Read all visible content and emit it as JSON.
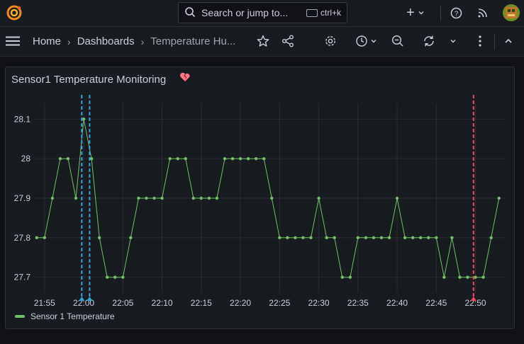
{
  "topbar": {
    "search_placeholder": "Search or jump to...",
    "search_shortcut": "ctrl+k",
    "icons": [
      "grafana-logo-icon",
      "search-icon",
      "keyboard-icon",
      "plus-icon",
      "help-icon",
      "news-icon",
      "avatar"
    ]
  },
  "navbar": {
    "breadcrumbs": [
      "Home",
      "Dashboards",
      "Temperature Hu..."
    ],
    "icons": [
      "menu-icon",
      "star-icon",
      "share-icon",
      "settings-icon",
      "time-picker-icon",
      "zoom-out-icon",
      "refresh-icon",
      "refresh-interval-chevron-icon",
      "more-icon",
      "collapse-icon"
    ]
  },
  "panel": {
    "title": "Sensor1 Temperature Monitoring",
    "title_icon": "broken-heart-icon"
  },
  "colors": {
    "series": "#73bf69",
    "annotation_blue": "#2aa8dc",
    "annotation_red": "#f2495c",
    "heart": "#ff7383",
    "grid": "#2a2d33"
  },
  "chart_data": {
    "type": "line",
    "title": "Sensor1 Temperature Monitoring",
    "xlabel": "",
    "ylabel": "",
    "x_ticks": [
      "21:55",
      "22:00",
      "22:05",
      "22:10",
      "22:15",
      "22:20",
      "22:25",
      "22:30",
      "22:35",
      "22:40",
      "22:45",
      "22:50"
    ],
    "y_ticks": [
      27.7,
      27.8,
      27.9,
      28,
      28.1
    ],
    "ylim": [
      27.66,
      28.14
    ],
    "xlim": [
      "21:53:45",
      "22:53:45"
    ],
    "grid": true,
    "legend": "bottom-left",
    "series": [
      {
        "name": "Sensor 1 Temperature",
        "x": [
          "21:54:00",
          "21:55:00",
          "21:56:00",
          "21:57:00",
          "21:58:00",
          "21:59:00",
          "22:00:00",
          "22:01:00",
          "22:02:00",
          "22:03:00",
          "22:04:00",
          "22:05:00",
          "22:06:00",
          "22:07:00",
          "22:08:00",
          "22:09:00",
          "22:10:00",
          "22:11:00",
          "22:12:00",
          "22:13:00",
          "22:14:00",
          "22:15:00",
          "22:16:00",
          "22:17:00",
          "22:18:00",
          "22:19:00",
          "22:20:00",
          "22:21:00",
          "22:22:00",
          "22:23:00",
          "22:24:00",
          "22:25:00",
          "22:26:00",
          "22:27:00",
          "22:28:00",
          "22:29:00",
          "22:30:00",
          "22:31:00",
          "22:32:00",
          "22:33:00",
          "22:34:00",
          "22:35:00",
          "22:36:00",
          "22:37:00",
          "22:38:00",
          "22:39:00",
          "22:40:00",
          "22:41:00",
          "22:42:00",
          "22:43:00",
          "22:44:00",
          "22:45:00",
          "22:46:00",
          "22:47:00",
          "22:48:00",
          "22:49:00",
          "22:50:00",
          "22:51:00",
          "22:52:00",
          "22:53:00"
        ],
        "y": [
          27.8,
          27.8,
          27.9,
          28.0,
          28.0,
          27.9,
          28.1,
          28.0,
          27.8,
          27.7,
          27.7,
          27.7,
          27.8,
          27.9,
          27.9,
          27.9,
          27.9,
          28.0,
          28.0,
          28.0,
          27.9,
          27.9,
          27.9,
          27.9,
          28.0,
          28.0,
          28.0,
          28.0,
          28.0,
          28.0,
          27.9,
          27.8,
          27.8,
          27.8,
          27.8,
          27.8,
          27.9,
          27.8,
          27.8,
          27.7,
          27.7,
          27.8,
          27.8,
          27.8,
          27.8,
          27.8,
          27.9,
          27.8,
          27.8,
          27.8,
          27.8,
          27.8,
          27.7,
          27.8,
          27.7,
          27.7,
          27.7,
          27.7,
          27.8,
          27.9
        ]
      }
    ],
    "annotations": [
      {
        "time": "21:59:45",
        "color": "#2aa8dc"
      },
      {
        "time": "22:00:45",
        "color": "#2aa8dc"
      },
      {
        "time": "22:49:45",
        "color": "#f2495c"
      }
    ]
  }
}
